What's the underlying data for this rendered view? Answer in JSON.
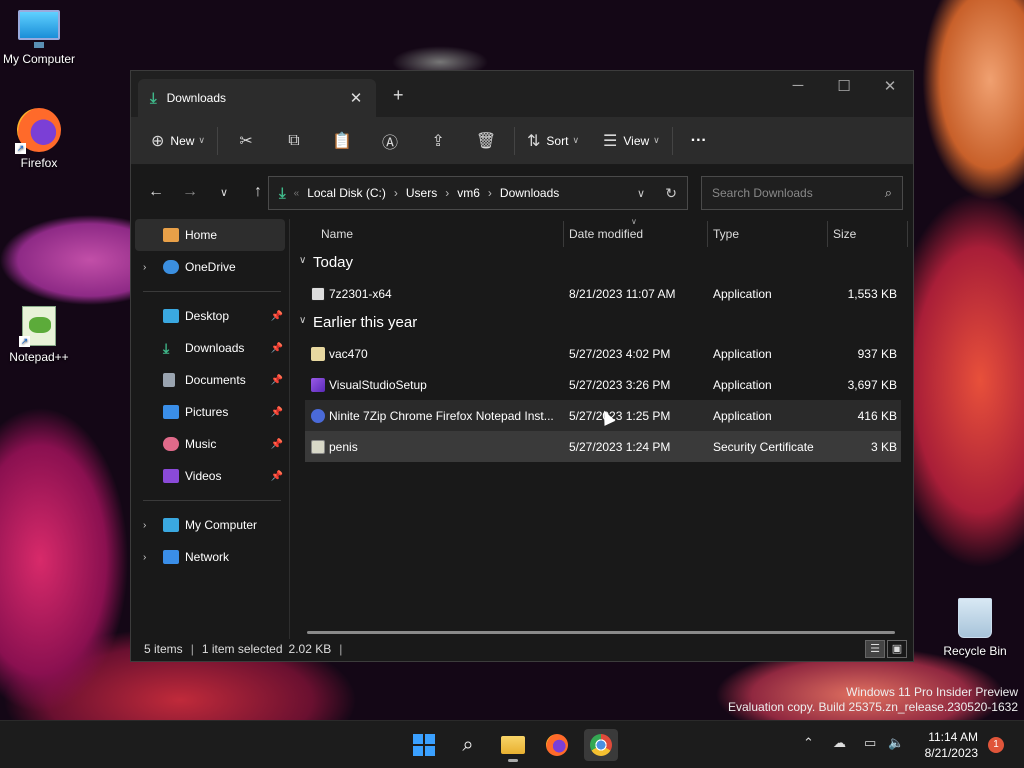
{
  "desktop": {
    "icons": [
      {
        "label": "My Computer"
      },
      {
        "label": "Firefox"
      },
      {
        "label": "Notepad++"
      },
      {
        "label": "Recycle Bin"
      }
    ],
    "watermark": {
      "line1": "Windows 11 Pro Insider Preview",
      "line2": "Evaluation copy. Build 25375.zn_release.230520-1632"
    }
  },
  "window": {
    "tab_title": "Downloads",
    "toolbar": {
      "new_label": "New",
      "sort_label": "Sort",
      "view_label": "View",
      "more_label": "···"
    },
    "address": {
      "crumbs": [
        "Local Disk (C:)",
        "Users",
        "vm6",
        "Downloads"
      ],
      "search_placeholder": "Search Downloads"
    },
    "nav": {
      "home": "Home",
      "onedrive": "OneDrive",
      "pinned": [
        "Desktop",
        "Downloads",
        "Documents",
        "Pictures",
        "Music",
        "Videos"
      ],
      "my_computer": "My Computer",
      "network": "Network"
    },
    "columns": {
      "name": "Name",
      "date": "Date modified",
      "type": "Type",
      "size": "Size"
    },
    "groups": [
      {
        "label": "Today",
        "files": [
          {
            "name": "7z2301-x64",
            "date": "8/21/2023 11:07 AM",
            "type": "Application",
            "size": "1,553 KB"
          }
        ]
      },
      {
        "label": "Earlier this year",
        "files": [
          {
            "name": "vac470",
            "date": "5/27/2023 4:02 PM",
            "type": "Application",
            "size": "937 KB"
          },
          {
            "name": "VisualStudioSetup",
            "date": "5/27/2023 3:26 PM",
            "type": "Application",
            "size": "3,697 KB"
          },
          {
            "name": "Ninite 7Zip Chrome Firefox Notepad Inst...",
            "date": "5/27/2023 1:25 PM",
            "type": "Application",
            "size": "416 KB"
          },
          {
            "name": "penis",
            "date": "5/27/2023 1:24 PM",
            "type": "Security Certificate",
            "size": "3 KB"
          }
        ]
      }
    ],
    "status": {
      "items": "5 items",
      "selection": "1 item selected",
      "selection_size": "2.02 KB"
    }
  },
  "taskbar": {
    "time": "11:14 AM",
    "date": "8/21/2023",
    "notifications": "1"
  },
  "colors": {
    "accent_green": "#3fb88a",
    "windows_blue": "#3aa0ff"
  }
}
